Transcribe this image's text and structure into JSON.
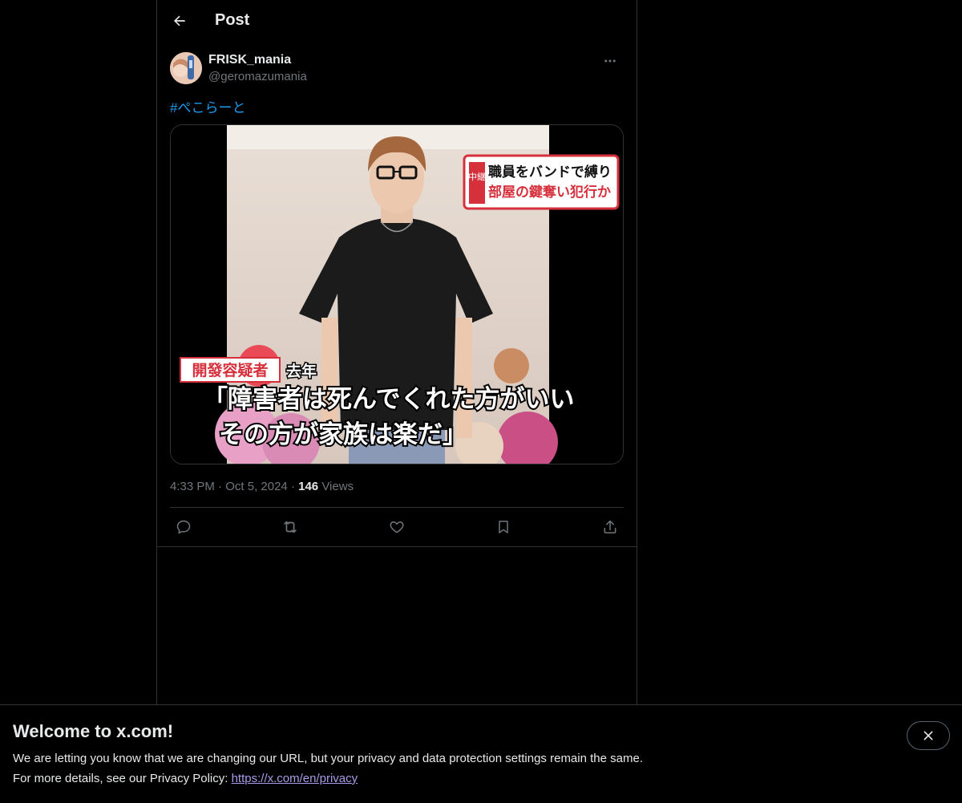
{
  "header": {
    "title": "Post"
  },
  "tweet": {
    "display_name": "FRISK_mania",
    "handle": "@geromazumania",
    "hashtag": "#ぺこらーと",
    "time": "4:33 PM",
    "separator": "·",
    "date": "Oct 5, 2024",
    "views_count": "146",
    "views_label": "Views"
  },
  "media": {
    "label_top_badge": "中継",
    "label_top_line1": "職員をバンドで縛り",
    "label_top_line2": "部屋の鍵奪い犯行か",
    "label_bottom_tag": "開發容疑者",
    "label_bottom_year": "去年",
    "quote_line1": "「障害者は死んでくれた方がいい",
    "quote_line2": "その方が家族は楽だ」"
  },
  "banner": {
    "title": "Welcome to x.com!",
    "line1": "We are letting you know that we are changing our URL, but your privacy and data protection settings remain the same.",
    "line2_prefix": "For more details, see our Privacy Policy: ",
    "link": "https://x.com/en/privacy"
  },
  "icons": {
    "back": "arrow-left-icon",
    "more": "more-horizontal-icon",
    "reply": "reply-icon",
    "repost": "repost-icon",
    "like": "heart-icon",
    "bookmark": "bookmark-icon",
    "share": "share-icon",
    "close": "close-icon"
  },
  "colors": {
    "background": "#000000",
    "text": "#e7e9ea",
    "muted": "#71767b",
    "accent": "#1d9bf0",
    "border": "#2f3336"
  }
}
